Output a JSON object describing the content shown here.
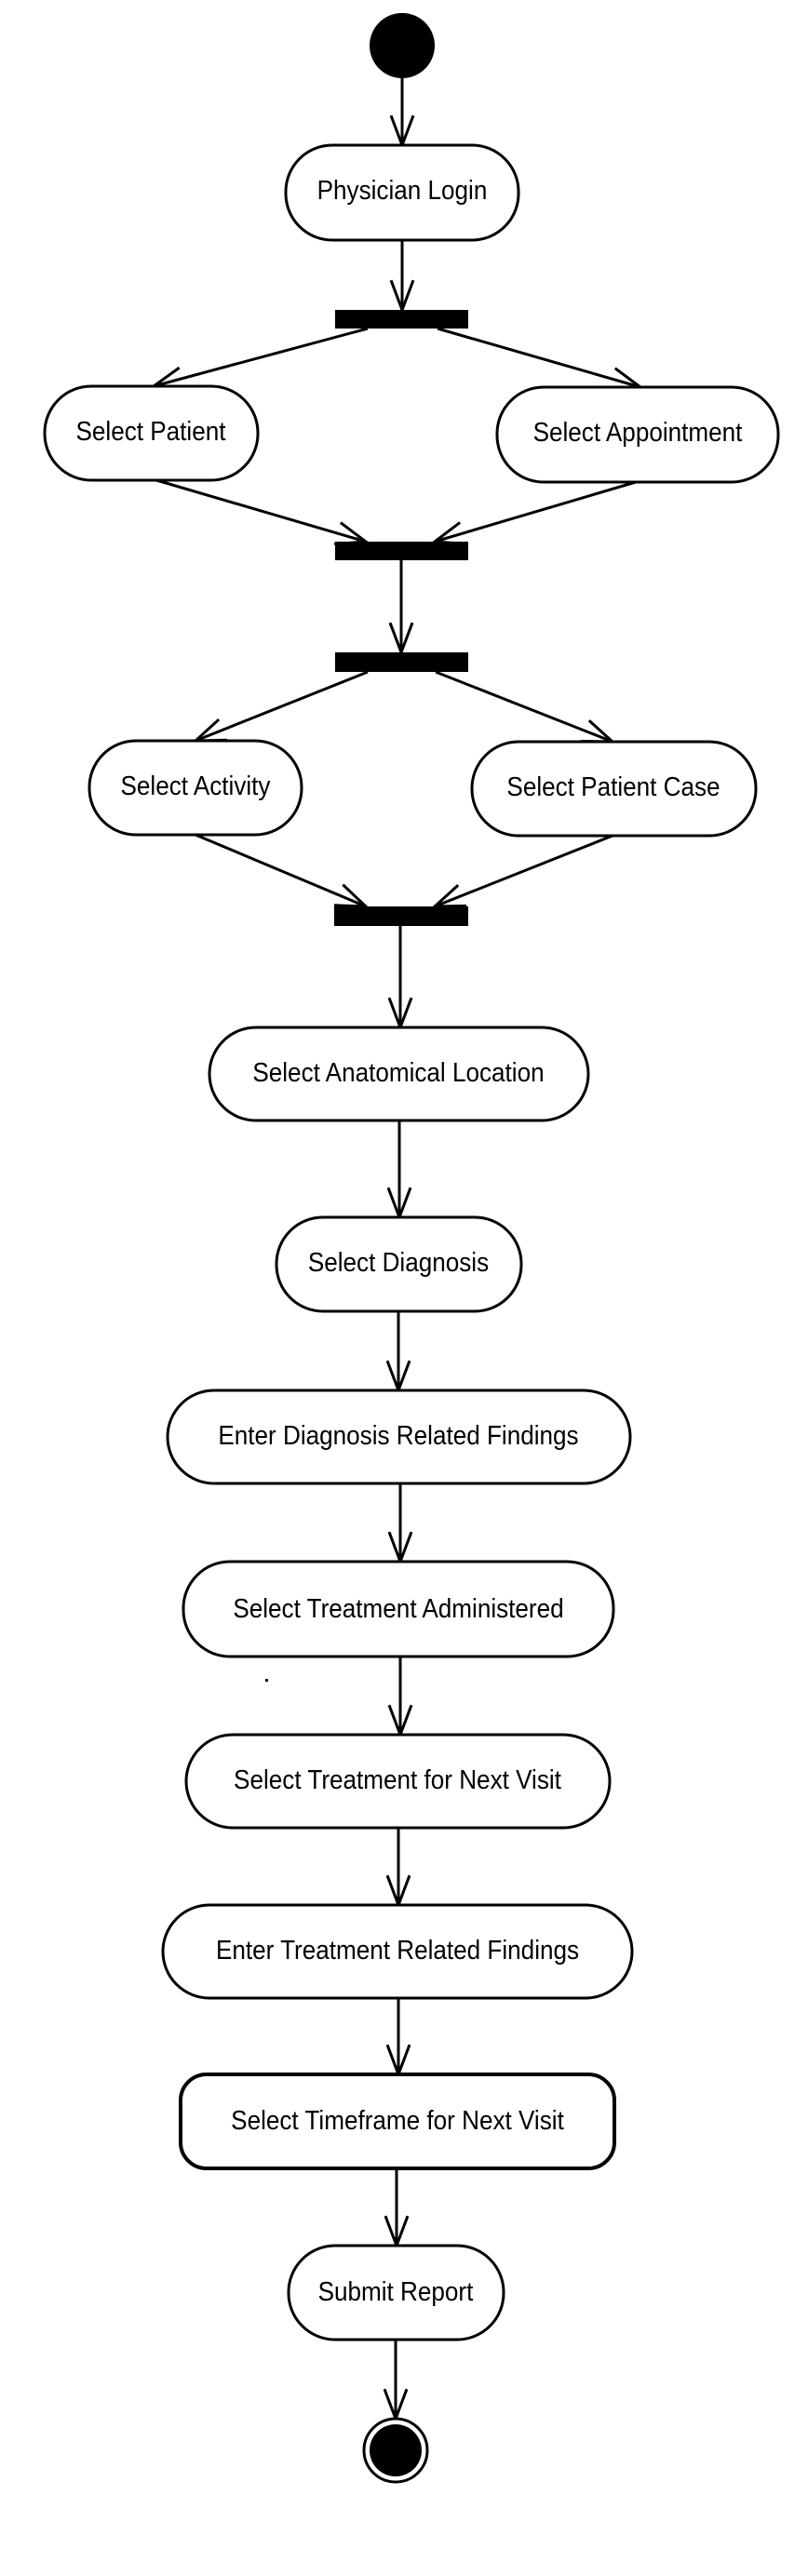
{
  "diagram": {
    "type": "UML activity diagram",
    "start": {
      "label": "initial-node"
    },
    "end": {
      "label": "final-node"
    },
    "activities": [
      {
        "id": "physician_login",
        "label": "Physician Login"
      },
      {
        "id": "select_patient",
        "label": "Select Patient"
      },
      {
        "id": "select_appointment",
        "label": "Select Appointment"
      },
      {
        "id": "select_activity",
        "label": "Select Activity"
      },
      {
        "id": "select_patient_case",
        "label": "Select Patient Case"
      },
      {
        "id": "select_anatomical_location",
        "label": "Select Anatomical Location"
      },
      {
        "id": "select_diagnosis",
        "label": "Select Diagnosis"
      },
      {
        "id": "enter_diagnosis_findings",
        "label": "Enter Diagnosis Related Findings"
      },
      {
        "id": "select_treatment_administered",
        "label": "Select Treatment Administered"
      },
      {
        "id": "select_treatment_next_visit",
        "label": "Select Treatment for Next Visit"
      },
      {
        "id": "enter_treatment_findings",
        "label": "Enter Treatment Related Findings"
      },
      {
        "id": "select_timeframe_next_visit",
        "label": "Select Timeframe for Next Visit"
      },
      {
        "id": "submit_report",
        "label": "Submit Report"
      }
    ],
    "bars": [
      {
        "id": "fork1",
        "kind": "fork"
      },
      {
        "id": "join1",
        "kind": "join"
      },
      {
        "id": "fork2",
        "kind": "fork"
      },
      {
        "id": "join2",
        "kind": "join"
      }
    ],
    "flows": [
      [
        "start",
        "physician_login"
      ],
      [
        "physician_login",
        "fork1"
      ],
      [
        "fork1",
        "select_patient"
      ],
      [
        "fork1",
        "select_appointment"
      ],
      [
        "select_patient",
        "join1"
      ],
      [
        "select_appointment",
        "join1"
      ],
      [
        "join1",
        "fork2"
      ],
      [
        "fork2",
        "select_activity"
      ],
      [
        "fork2",
        "select_patient_case"
      ],
      [
        "select_activity",
        "join2"
      ],
      [
        "select_patient_case",
        "join2"
      ],
      [
        "join2",
        "select_anatomical_location"
      ],
      [
        "select_anatomical_location",
        "select_diagnosis"
      ],
      [
        "select_diagnosis",
        "enter_diagnosis_findings"
      ],
      [
        "enter_diagnosis_findings",
        "select_treatment_administered"
      ],
      [
        "select_treatment_administered",
        "select_treatment_next_visit"
      ],
      [
        "select_treatment_next_visit",
        "enter_treatment_findings"
      ],
      [
        "enter_treatment_findings",
        "select_timeframe_next_visit"
      ],
      [
        "select_timeframe_next_visit",
        "submit_report"
      ],
      [
        "submit_report",
        "end"
      ]
    ]
  }
}
